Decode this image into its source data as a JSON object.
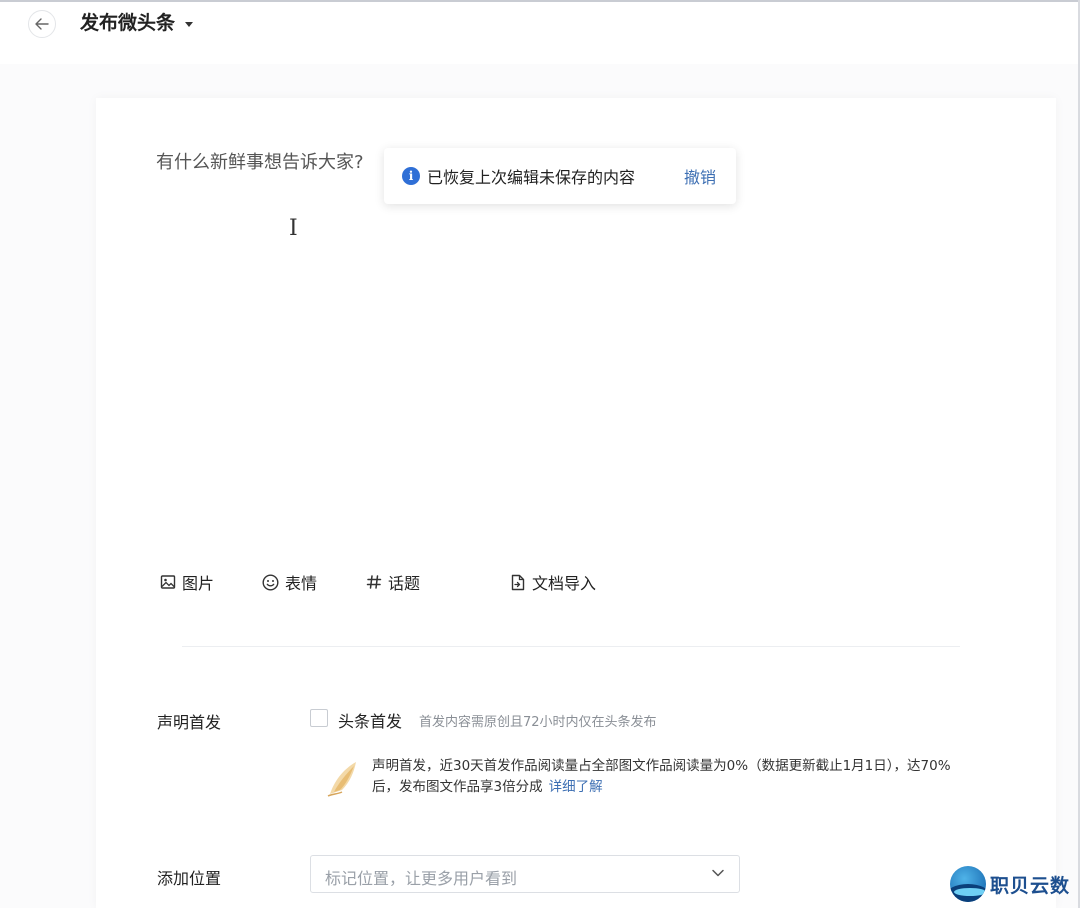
{
  "header": {
    "title": "发布微头条"
  },
  "editor": {
    "placeholder": "有什么新鲜事想告诉大家?"
  },
  "toast": {
    "message": "已恢复上次编辑未保存的内容",
    "undo_label": "撤销",
    "icon": "info-icon"
  },
  "toolbar": {
    "items": [
      {
        "label": "图片",
        "icon": "image-icon"
      },
      {
        "label": "表情",
        "icon": "emoji-icon"
      },
      {
        "label": "话题",
        "icon": "hashtag-icon"
      },
      {
        "label": "文档导入",
        "icon": "document-import-icon"
      }
    ]
  },
  "declaration": {
    "label": "声明首发",
    "checkbox_label": "头条首发",
    "checkbox_checked": false,
    "hint": "首发内容需原创且72小时内仅在头条发布",
    "banner_text": "声明首发，近30天首发作品阅读量占全部图文作品阅读量为0%（数据更新截止1月1日），达70%后，发布图文作品享3倍分成",
    "banner_link": "详细了解"
  },
  "location": {
    "label": "添加位置",
    "placeholder": "标记位置，让更多用户看到"
  },
  "watermark": {
    "text": "职贝云数"
  },
  "colors": {
    "accent_link": "#3d6fb3",
    "info_blue": "#2f6fd6"
  }
}
